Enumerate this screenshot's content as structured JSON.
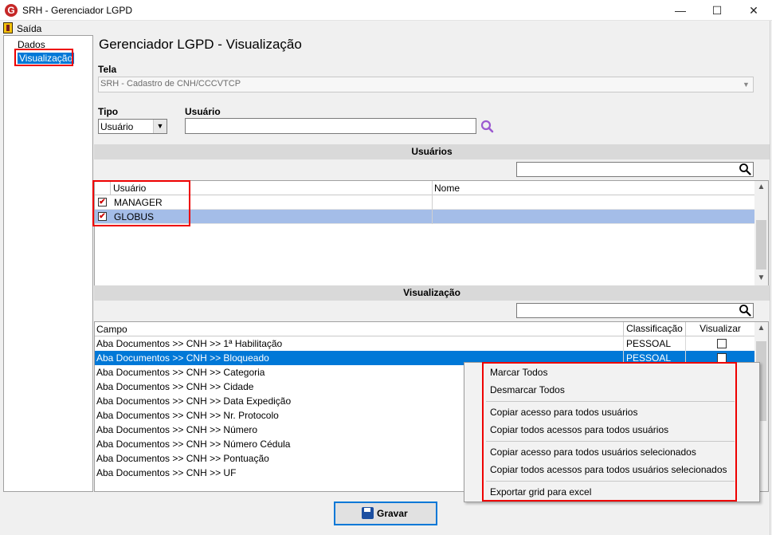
{
  "window": {
    "title": "SRH - Gerenciador LGPD",
    "app_icon": "G",
    "minimize_glyph": "—",
    "maximize_glyph": "☐",
    "close_glyph": "✕"
  },
  "menu": {
    "exit_label": "Saída"
  },
  "tree": {
    "items": [
      {
        "label": "Dados"
      },
      {
        "label": "Visualização"
      }
    ]
  },
  "page": {
    "title": "Gerenciador LGPD - Visualização"
  },
  "tela": {
    "label": "Tela",
    "value": "SRH - Cadastro de CNH/CCCVTCP"
  },
  "tipo": {
    "label": "Tipo",
    "value": "Usuário"
  },
  "usuario": {
    "label": "Usuário",
    "value": ""
  },
  "users_section": {
    "title": "Usuários",
    "columns": [
      "Usuário",
      "Nome"
    ],
    "rows": [
      {
        "usuario": "MANAGER",
        "nome": "",
        "checked": true
      },
      {
        "usuario": "GLOBUS",
        "nome": "",
        "checked": true
      }
    ],
    "check_glyph": "✔"
  },
  "vis_section": {
    "title": "Visualização",
    "columns": [
      "Campo",
      "Classificação",
      "Visualizar"
    ],
    "rows": [
      {
        "campo": "Aba Documentos >> CNH >> 1ª Habilitação",
        "classificacao": "PESSOAL"
      },
      {
        "campo": "Aba Documentos >> CNH >> Bloqueado",
        "classificacao": "PESSOAL"
      },
      {
        "campo": "Aba Documentos >> CNH >> Categoria",
        "classificacao": ""
      },
      {
        "campo": "Aba Documentos >> CNH >> Cidade",
        "classificacao": ""
      },
      {
        "campo": "Aba Documentos >> CNH >> Data Expedição",
        "classificacao": ""
      },
      {
        "campo": "Aba Documentos >> CNH >> Nr. Protocolo",
        "classificacao": ""
      },
      {
        "campo": "Aba Documentos >> CNH >> Número",
        "classificacao": ""
      },
      {
        "campo": "Aba Documentos >> CNH >> Número Cédula",
        "classificacao": ""
      },
      {
        "campo": "Aba Documentos >> CNH >> Pontuação",
        "classificacao": ""
      },
      {
        "campo": "Aba Documentos >> CNH >> UF",
        "classificacao": ""
      }
    ]
  },
  "context_menu": {
    "items": [
      "Marcar Todos",
      "Desmarcar Todos",
      "Copiar acesso para todos usuários",
      "Copiar todos acessos para todos usuários",
      "Copiar acesso para todos usuários selecionados",
      "Copiar todos acessos para todos usuários selecionados",
      "Exportar grid para excel"
    ]
  },
  "buttons": {
    "save_label": "Gravar"
  },
  "scroll": {
    "up": "▲",
    "down": "▼"
  },
  "combo_arrow": "▼",
  "icons": {
    "app": "lgpd-app-icon",
    "exit": "door-exit-icon",
    "search": "magnifier-icon",
    "save": "floppy-disk-icon"
  },
  "colors": {
    "selection": "#0078d7",
    "row_highlight": "#a4bde8",
    "annotation_red": "#e00000",
    "search_purple": "#9b59d0"
  }
}
